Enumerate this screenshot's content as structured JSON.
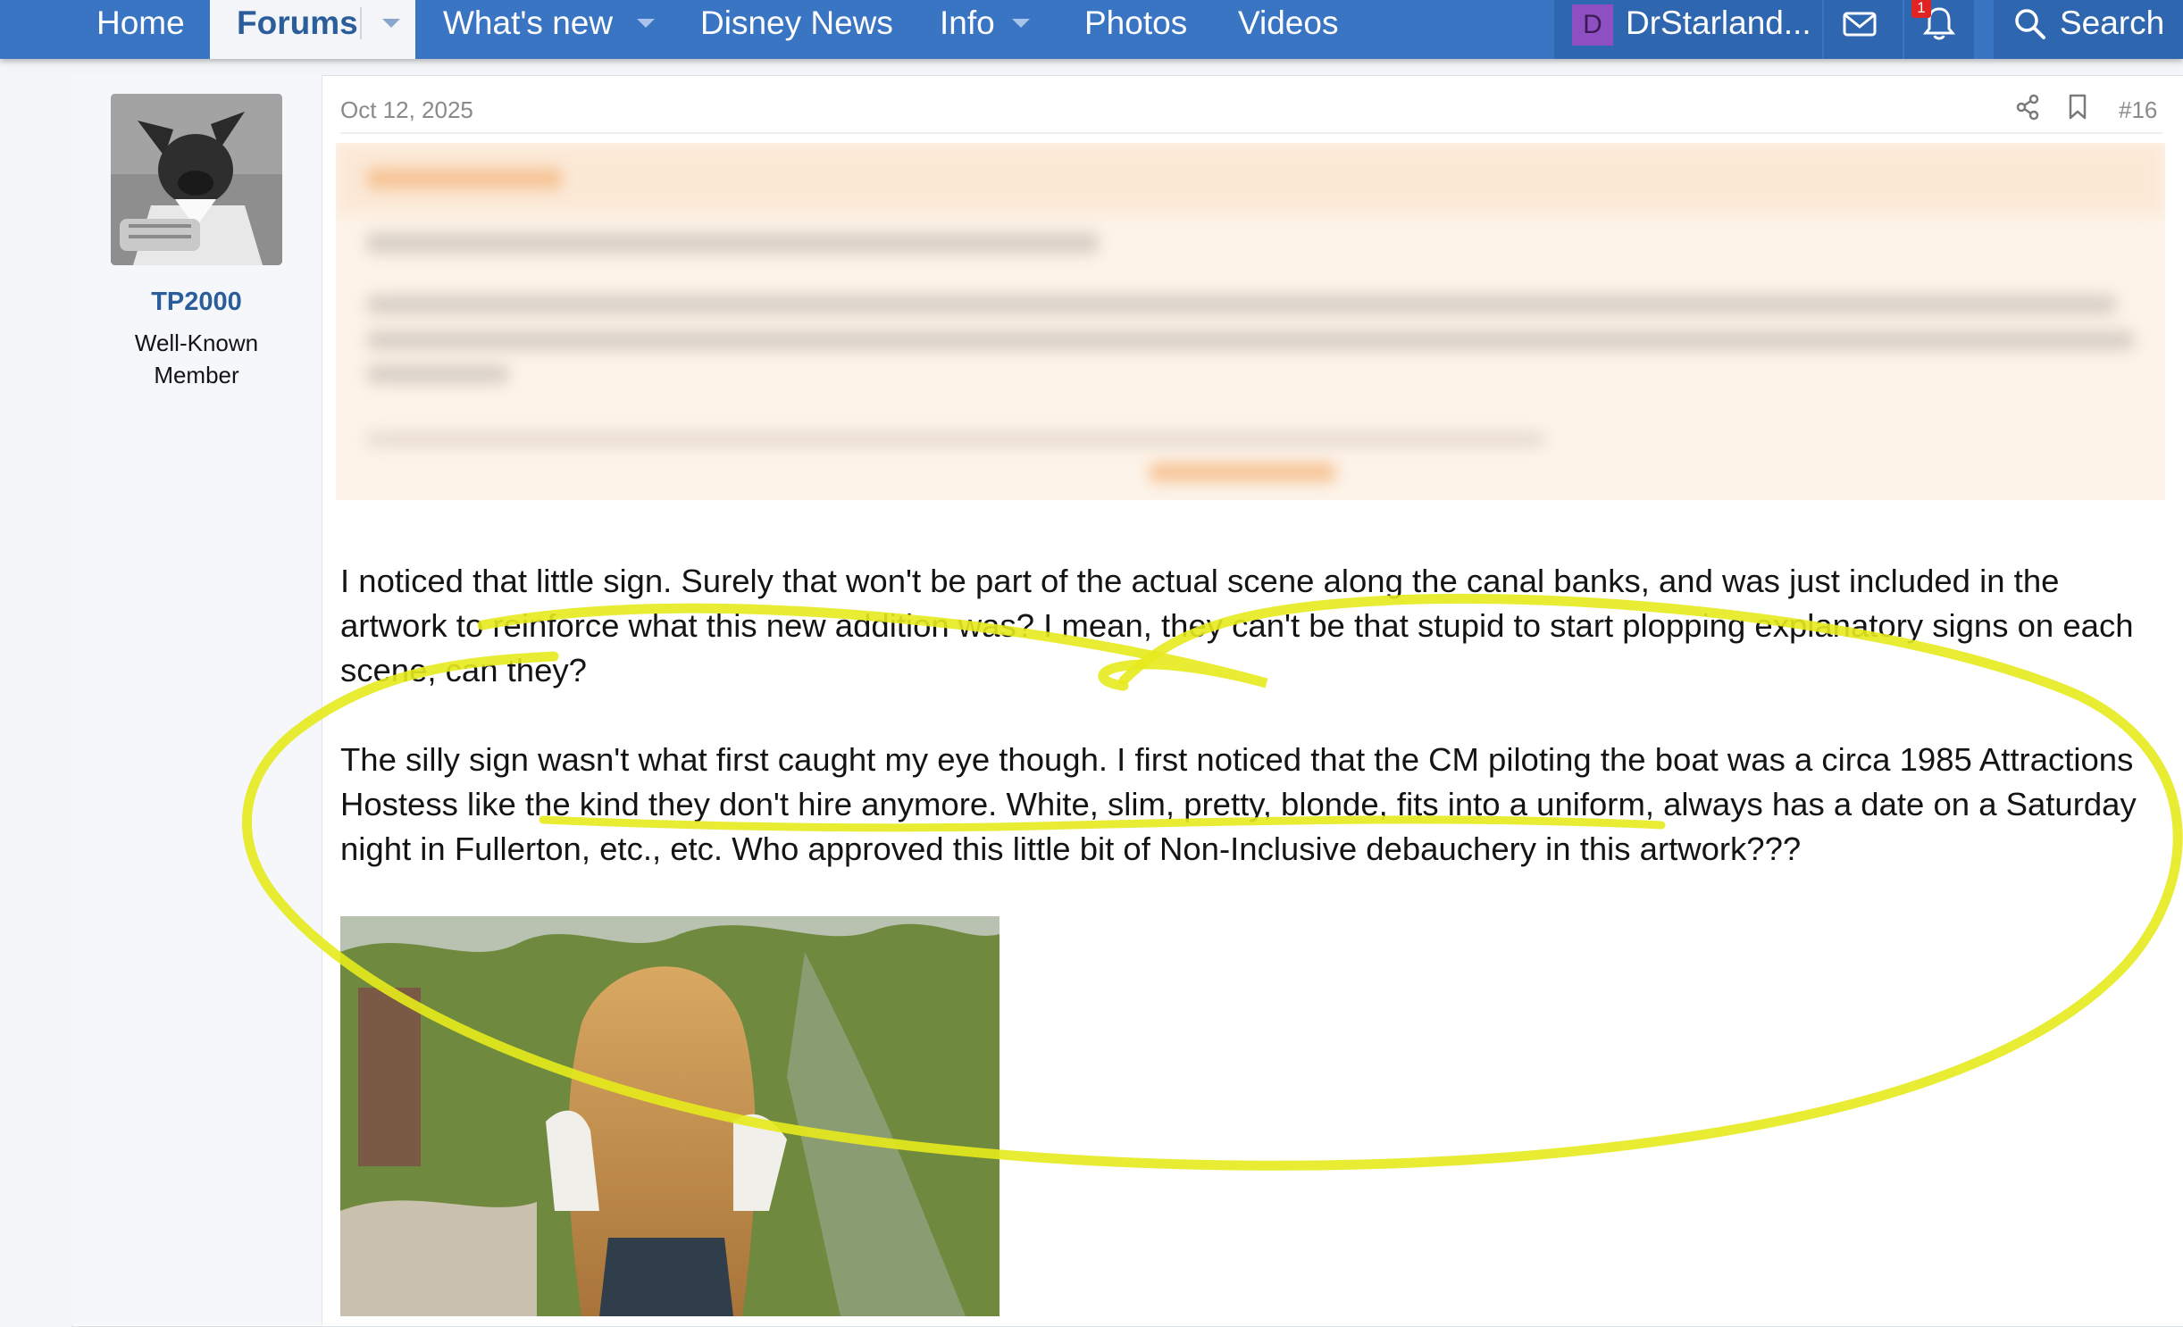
{
  "nav": {
    "home": "Home",
    "forums": "Forums",
    "whats_new": "What's new",
    "disney_news": "Disney News",
    "info": "Info",
    "photos": "Photos",
    "videos": "Videos",
    "avatar_letter": "D",
    "username": "DrStarland...",
    "alert_count": "1",
    "search": "Search"
  },
  "post": {
    "date": "Oct 12, 2025",
    "number": "#16",
    "author": {
      "name": "TP2000",
      "title": "Well-Known Member"
    },
    "paragraphs": [
      "I noticed that little sign. Surely that won't be part of the actual scene along the canal banks, and was just included in the artwork to reinforce what this new addition was? I mean, they can't be that stupid to start plopping explanatory signs on each scene, can they?",
      "The silly sign wasn't what first caught my eye though. I first noticed that the CM piloting the boat was a circa 1985 Attractions Hostess like the kind they don't hire anymore. White, slim, pretty, blonde, fits into a uniform, always has a date on a Saturday night in Fullerton, etc., etc. Who approved this little bit of Non-Inclusive debauchery in this artwork???"
    ]
  },
  "colors": {
    "nav_bg": "#3a75c4",
    "link": "#2b5d9b",
    "highlight_marker": "#e6ea1c",
    "quote_bg": "#fdf3e8"
  }
}
